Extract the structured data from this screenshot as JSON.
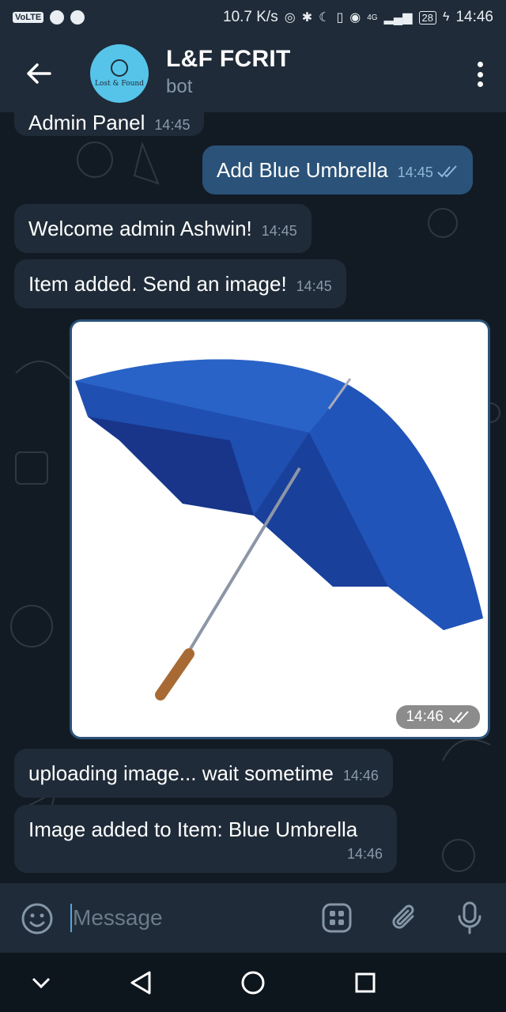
{
  "status_bar": {
    "left_badge": "VoLTE",
    "speed": "10.7 K/s",
    "network": "4G",
    "battery": "28",
    "time": "14:46"
  },
  "header": {
    "title": "L&F FCRIT",
    "subtitle": "bot",
    "avatar_text": "Lost & Found"
  },
  "messages": [
    {
      "text": "Admin Panel",
      "time": "14:45",
      "direction": "in"
    },
    {
      "text": "Add Blue Umbrella",
      "time": "14:45",
      "direction": "out",
      "status": "read"
    },
    {
      "text": "Welcome admin Ashwin!",
      "time": "14:45",
      "direction": "in"
    },
    {
      "text": "Item added. Send an image!",
      "time": "14:45",
      "direction": "in"
    },
    {
      "type": "photo",
      "subject": "blue umbrella",
      "time": "14:46",
      "direction": "out",
      "status": "read"
    },
    {
      "text": "uploading image... wait sometime",
      "time": "14:46",
      "direction": "in"
    },
    {
      "text": "Image added to Item: Blue Umbrella",
      "time": "14:46",
      "direction": "in"
    }
  ],
  "input": {
    "placeholder": "Message"
  },
  "colors": {
    "header_bg": "#1f2b38",
    "chat_bg": "#121b24",
    "incoming_bubble": "#1f2b38",
    "outgoing_bubble": "#2b5278",
    "accent": "#5aa4e0"
  },
  "icons": [
    "back-arrow-icon",
    "more-vert-icon",
    "emoji-icon",
    "sticker-icon",
    "attach-icon",
    "mic-icon",
    "nav-down-icon",
    "nav-back-icon",
    "nav-home-icon",
    "nav-recents-icon"
  ]
}
